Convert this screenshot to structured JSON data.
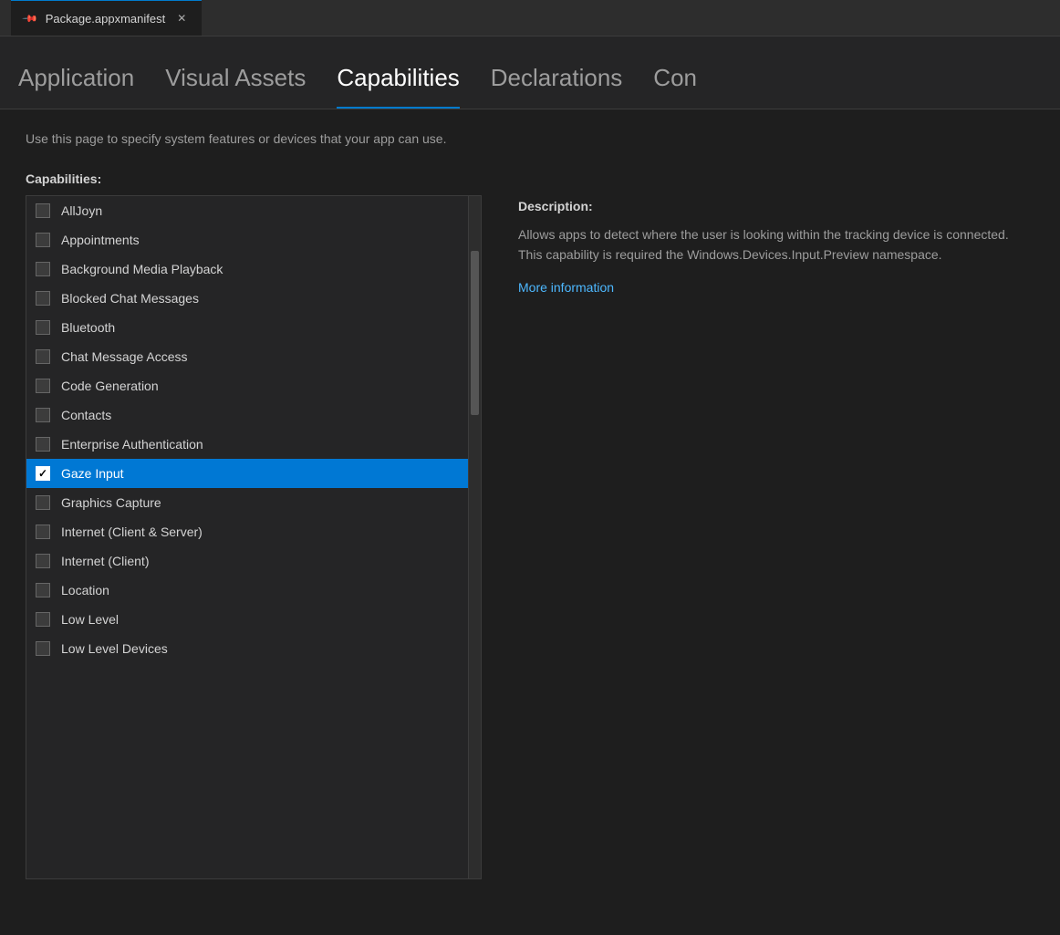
{
  "titlebar": {
    "tab_label": "Package.appxmanifest",
    "pin_label": "📌",
    "close_label": "✕"
  },
  "nav": {
    "tabs": [
      {
        "id": "application",
        "label": "Application",
        "active": false
      },
      {
        "id": "visual-assets",
        "label": "Visual Assets",
        "active": false
      },
      {
        "id": "capabilities",
        "label": "Capabilities",
        "active": true
      },
      {
        "id": "declarations",
        "label": "Declarations",
        "active": false
      },
      {
        "id": "con",
        "label": "Con",
        "active": false
      }
    ]
  },
  "main": {
    "description": "Use this page to specify system features or devices that your app can use.",
    "capabilities_title": "Capabilities:",
    "description_title": "Description:",
    "description_text": "Allows apps to detect where the user is looking within the tracking device is connected. This capability is required the Windows.Devices.Input.Preview namespace.",
    "more_info_label": "More information",
    "capabilities": [
      {
        "id": "alljoyn",
        "label": "AllJoyn",
        "checked": false,
        "selected": false
      },
      {
        "id": "appointments",
        "label": "Appointments",
        "checked": false,
        "selected": false
      },
      {
        "id": "background-media-playback",
        "label": "Background Media Playback",
        "checked": false,
        "selected": false
      },
      {
        "id": "blocked-chat-messages",
        "label": "Blocked Chat Messages",
        "checked": false,
        "selected": false
      },
      {
        "id": "bluetooth",
        "label": "Bluetooth",
        "checked": false,
        "selected": false
      },
      {
        "id": "chat-message-access",
        "label": "Chat Message Access",
        "checked": false,
        "selected": false
      },
      {
        "id": "code-generation",
        "label": "Code Generation",
        "checked": false,
        "selected": false
      },
      {
        "id": "contacts",
        "label": "Contacts",
        "checked": false,
        "selected": false
      },
      {
        "id": "enterprise-authentication",
        "label": "Enterprise Authentication",
        "checked": false,
        "selected": false
      },
      {
        "id": "gaze-input",
        "label": "Gaze Input",
        "checked": true,
        "selected": true
      },
      {
        "id": "graphics-capture",
        "label": "Graphics Capture",
        "checked": false,
        "selected": false
      },
      {
        "id": "internet-client-server",
        "label": "Internet (Client & Server)",
        "checked": false,
        "selected": false
      },
      {
        "id": "internet-client",
        "label": "Internet (Client)",
        "checked": false,
        "selected": false
      },
      {
        "id": "location",
        "label": "Location",
        "checked": false,
        "selected": false
      },
      {
        "id": "low-level",
        "label": "Low Level",
        "checked": false,
        "selected": false
      },
      {
        "id": "low-level-devices",
        "label": "Low Level Devices",
        "checked": false,
        "selected": false
      }
    ]
  }
}
